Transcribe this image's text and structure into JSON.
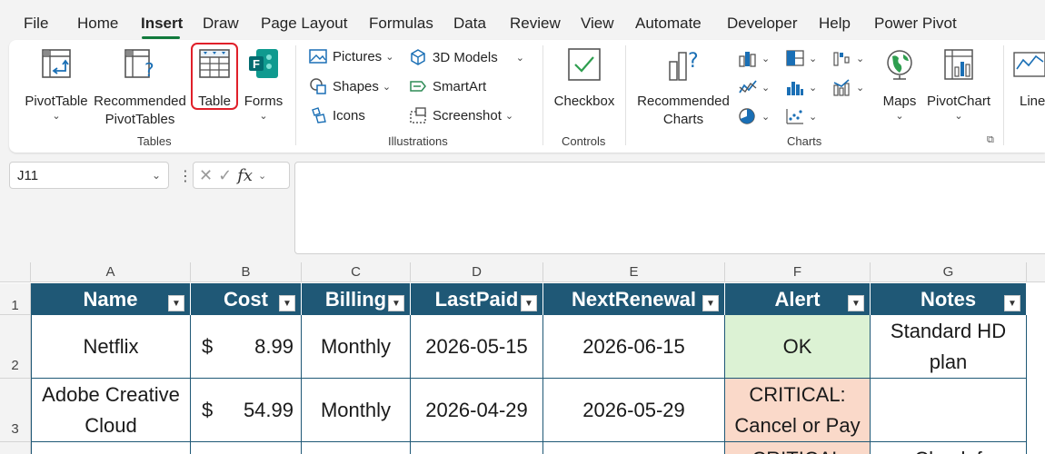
{
  "menu": {
    "items": [
      "File",
      "Home",
      "Insert",
      "Draw",
      "Page Layout",
      "Formulas",
      "Data",
      "Review",
      "View",
      "Automate",
      "Developer",
      "Help",
      "Power Pivot"
    ],
    "active": "Insert"
  },
  "ribbon": {
    "tables": {
      "label": "Tables",
      "pivottable": "PivotTable",
      "recommended_pivot_1": "Recommended",
      "recommended_pivot_2": "PivotTables",
      "table": "Table",
      "forms": "Forms"
    },
    "illustrations": {
      "label": "Illustrations",
      "pictures": "Pictures",
      "shapes": "Shapes",
      "icons": "Icons",
      "models": "3D Models",
      "smartart": "SmartArt",
      "screenshot": "Screenshot"
    },
    "controls": {
      "label": "Controls",
      "checkbox": "Checkbox"
    },
    "charts": {
      "label": "Charts",
      "recommended_1": "Recommended",
      "recommended_2": "Charts",
      "maps": "Maps",
      "pivotchart": "PivotChart"
    },
    "line_partial": "Line"
  },
  "formula_bar": {
    "name_box": "J11",
    "fx": "fx",
    "formula": ""
  },
  "grid": {
    "columns": [
      "A",
      "B",
      "C",
      "D",
      "E",
      "F",
      "G"
    ],
    "rows": [
      "1",
      "2",
      "3"
    ],
    "headers": [
      "Name",
      "Cost",
      "Billing",
      "LastPaid",
      "NextRenewal",
      "Alert",
      "Notes"
    ],
    "data": [
      {
        "name": "Netflix",
        "currency": "$",
        "cost": "8.99",
        "billing": "Monthly",
        "last_paid": "2026-05-15",
        "next_renewal": "2026-06-15",
        "alert": "OK",
        "notes": "Standard HD plan"
      },
      {
        "name": "Adobe Creative Cloud",
        "currency": "$",
        "cost": "54.99",
        "billing": "Monthly",
        "last_paid": "2026-04-29",
        "next_renewal": "2026-05-29",
        "alert": "CRITICAL: Cancel or Pay",
        "notes": ""
      }
    ],
    "partial_row": {
      "alert": "CRITICAL",
      "notes": "Check f"
    }
  },
  "colors": {
    "header_fill": "#1f5876",
    "ok_fill": "#dcf2d4",
    "critical_fill": "#fad9c9",
    "highlight": "#e0202a",
    "accent": "#117a3c"
  }
}
